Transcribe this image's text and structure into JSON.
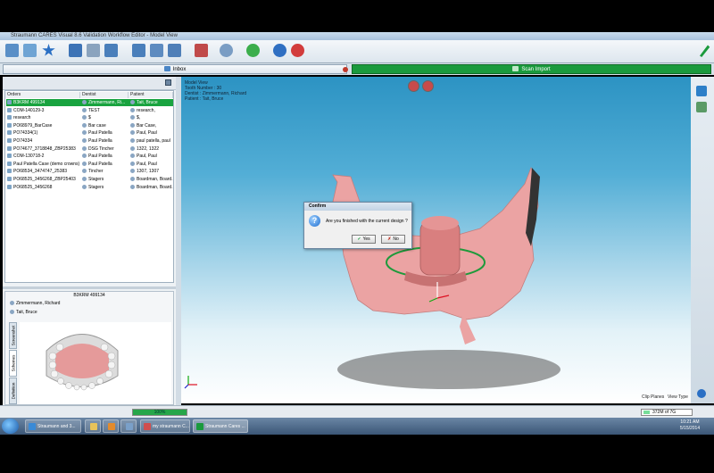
{
  "app": {
    "title": "Straumann CARES Visual 8.6 Validation Workflow Editor - Model View"
  },
  "tabs": [
    {
      "label": "Inbox",
      "active": false
    },
    {
      "label": "Scan Import",
      "active": true
    }
  ],
  "orders_table": {
    "columns": [
      "Orders",
      "Dentist",
      "Patient"
    ],
    "rows": [
      {
        "order": "B3KRM 499134",
        "dentist": "Zimmermann, Ri...",
        "patient": "Tait, Bruce",
        "selected": true
      },
      {
        "order": "COM-140129-3",
        "dentist": "TEST",
        "patient": "research,"
      },
      {
        "order": "research",
        "dentist": "$",
        "patient": "$,"
      },
      {
        "order": "PO68979_BarCase",
        "dentist": "Bar case",
        "patient": "Bar Case,"
      },
      {
        "order": "PO74334(1)",
        "dentist": "Paul Patella",
        "patient": "Paul, Paul"
      },
      {
        "order": "PO74334",
        "dentist": "Paul Patella",
        "patient": "paul patella, paul"
      },
      {
        "order": "PO74677_3718848_ZBP25383",
        "dentist": "DSG Tincher",
        "patient": "1322, 1322"
      },
      {
        "order": "COM-130718-2",
        "dentist": "Paul Patella",
        "patient": "Paul, Paul"
      },
      {
        "order": "Paul Patella Case (demo crowns)",
        "dentist": "Paul Patella",
        "patient": "Paul, Paul"
      },
      {
        "order": "PO68534_3474747_25383",
        "dentist": "Tincher",
        "patient": "1307, 1307"
      },
      {
        "order": "PO68525_3456268_ZBP25403",
        "dentist": "Stagers",
        "patient": "Boardman, Board..."
      },
      {
        "order": "PO68525_3456268",
        "dentist": "Stagers",
        "patient": "Boardman, Board..."
      }
    ]
  },
  "detail": {
    "order_id": "B3KRM 499134",
    "dentist": "Zimmermann, Richard",
    "patient": "Tait, Bruce",
    "side_tabs": [
      "Screenshot",
      "Schemes",
      "Definition"
    ]
  },
  "model_view": {
    "title": "Model View",
    "tooth_number": "Tooth Number : 30",
    "dentist": "Dentist : Zimmermann, Richard",
    "patient": "Patient : Tait, Bruce",
    "clip_planes": "Clip Planes",
    "view_type": "View Type"
  },
  "dialog": {
    "title": "Confirm",
    "message": "Are you finished with the current design ?",
    "yes": "Yes",
    "no": "No"
  },
  "status": {
    "progress_label": "100%",
    "progress_value": 1.0,
    "memory": "372M of 7G"
  },
  "taskbar": {
    "items": [
      "Straumann and 3...",
      "",
      "",
      "",
      "my straumann C...",
      "Straumann Cares ..."
    ],
    "time": "10:21 AM",
    "date": "5/15/2014"
  },
  "colors": {
    "accent_green": "#1a9a3d",
    "gum_pink": "#e9a2a2",
    "sky_blue": "#2c93c3"
  }
}
